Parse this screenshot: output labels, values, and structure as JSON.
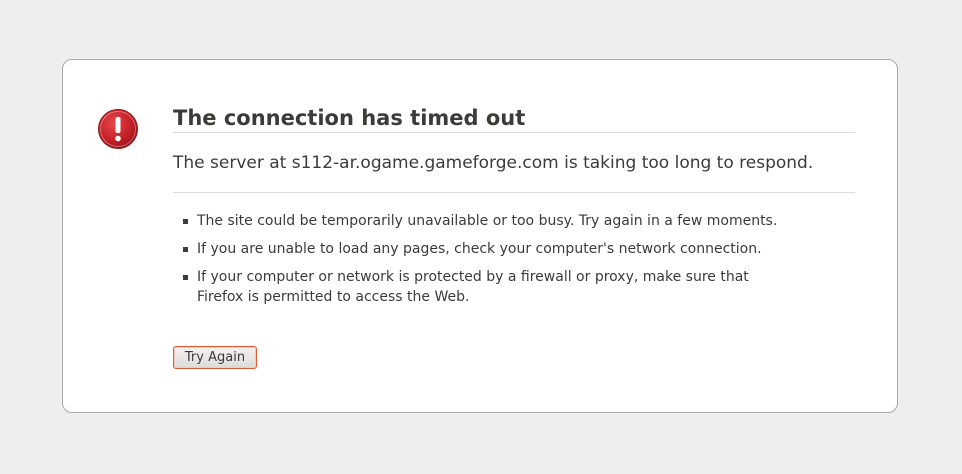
{
  "error": {
    "icon": "alert-icon",
    "title": "The connection has timed out",
    "message": "The server at s112-ar.ogame.gameforge.com is taking too long to respond.",
    "suggestions": [
      "The site could be temporarily unavailable or too busy. Try again in a few moments.",
      "If you are unable to load any pages, check your computer's network connection.",
      "If your computer or network is protected by a firewall or proxy, make sure that Firefox is permitted to access the Web."
    ],
    "try_again_label": "Try Again"
  },
  "colors": {
    "page_background": "#efeeed",
    "box_background": "#ffffff",
    "icon_red": "#c8242b",
    "button_border": "#e05a35",
    "text": "#3c3b37"
  }
}
